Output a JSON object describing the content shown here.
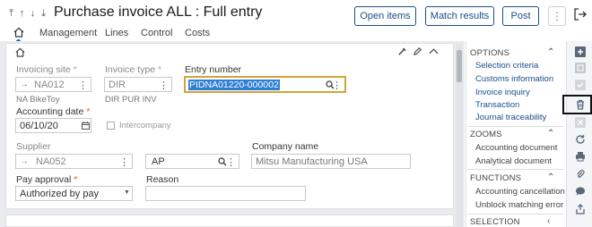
{
  "header": {
    "title": "Purchase invoice ALL : Full entry",
    "buttons": {
      "open_items": "Open items",
      "match_results": "Match results",
      "post": "Post"
    },
    "kebab": "⋮"
  },
  "tabs": [
    "Management",
    "Lines",
    "Control",
    "Costs"
  ],
  "form": {
    "invoicing_site": {
      "label": "Invoicing site",
      "value": "NA012",
      "desc": "NA BikeToy"
    },
    "invoice_type": {
      "label": "Invoice type",
      "value": "DIR",
      "desc": "DIR PUR INV"
    },
    "entry_number": {
      "label": "Entry number",
      "value": "PIDNA01220-000002"
    },
    "accounting_date": {
      "label": "Accounting date",
      "value": "06/10/20"
    },
    "intercompany": {
      "label": "Intercompany"
    },
    "supplier": {
      "label": "Supplier",
      "value": "NA052",
      "value2": "AP"
    },
    "company_name": {
      "label": "Company name",
      "value": "Mitsu Manufacturing USA"
    },
    "pay_approval": {
      "label": "Pay approval",
      "value": "Authorized by pay"
    },
    "reason": {
      "label": "Reason",
      "value": ""
    },
    "required_mark": "*"
  },
  "right_panel": {
    "options": {
      "header": "OPTIONS",
      "items": [
        "Selection criteria",
        "Customs information",
        "Invoice inquiry",
        "Transaction",
        "Journal traceability"
      ]
    },
    "zooms": {
      "header": "ZOOMS",
      "items": [
        "Accounting document",
        "Analytical document"
      ]
    },
    "functions": {
      "header": "FUNCTIONS",
      "items": [
        "Accounting cancellation",
        "Unblock matching error"
      ]
    },
    "selection": {
      "header": "SELECTION"
    }
  },
  "colors": {
    "accent": "#1a4f8b",
    "highlight": "#2f7fd6",
    "required": "#e05a1a",
    "toolbar_icon": "#5a6878"
  }
}
